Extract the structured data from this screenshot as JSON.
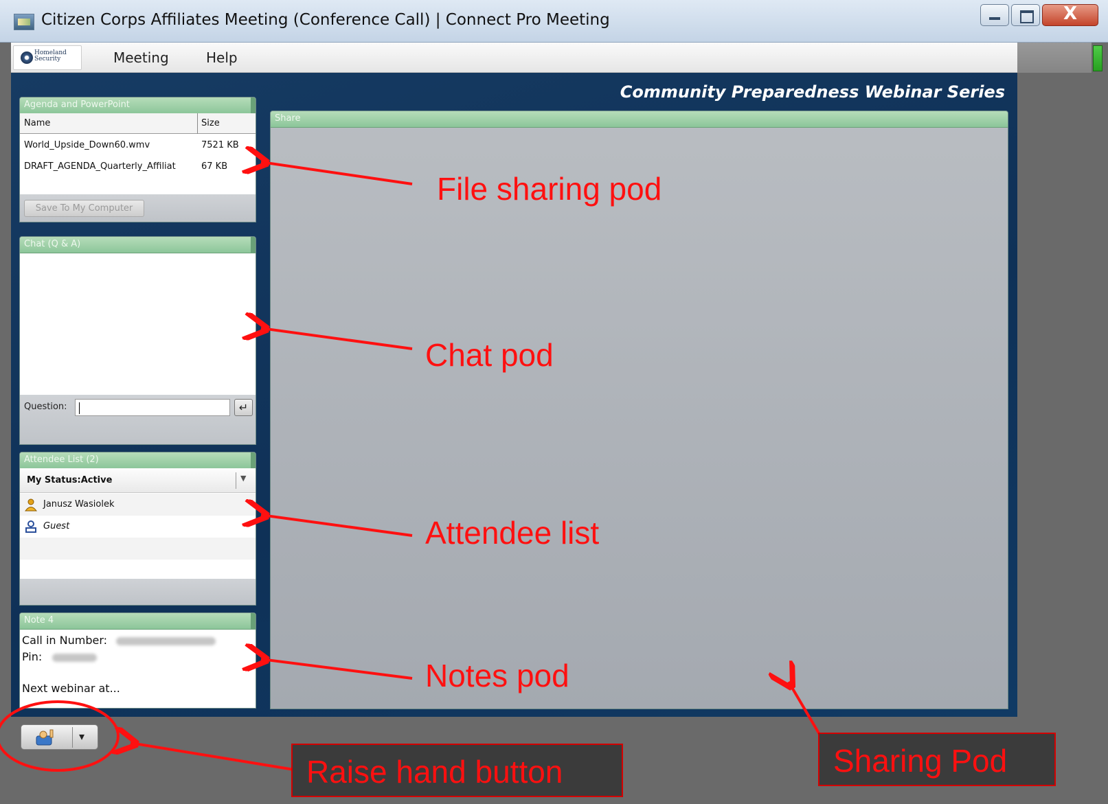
{
  "window": {
    "title": "Citizen Corps Affiliates Meeting (Conference Call) | Connect Pro Meeting",
    "controls": {
      "minimize": "",
      "maximize": "",
      "close": "X"
    }
  },
  "menubar": {
    "logo_text": "Homeland Security",
    "items": [
      "Meeting",
      "Help"
    ]
  },
  "banner": {
    "title": "Community Preparedness Webinar Series"
  },
  "file_pod": {
    "title": "Agenda and PowerPoint",
    "columns": [
      "Name",
      "Size"
    ],
    "rows": [
      {
        "name": "World_Upside_Down60.wmv",
        "size": "7521 KB"
      },
      {
        "name": "DRAFT_AGENDA_Quarterly_Affiliat",
        "size": "67 KB"
      }
    ],
    "save_button": "Save To My Computer"
  },
  "chat_pod": {
    "title": "Chat (Q & A)",
    "question_label": "Question:",
    "question_value": "",
    "send_icon": "↵"
  },
  "attendee_pod": {
    "title": "Attendee List (2)",
    "my_status": "My Status:Active",
    "attendees": [
      {
        "name": "Janusz Wasiolek",
        "role_icon": "host-icon"
      },
      {
        "name": "Guest",
        "role_icon": "guest-icon"
      }
    ]
  },
  "notes_pod": {
    "title": "Note 4",
    "call_in_label": "Call in Number:",
    "pin_label": "Pin:",
    "next_text": "Next webinar at..."
  },
  "share_pod": {
    "title": "Share"
  },
  "raise_hand": {
    "arrow": "▾"
  },
  "annotations": {
    "file_sharing": "File sharing pod",
    "chat": "Chat pod",
    "attendee": "Attendee list",
    "notes": "Notes pod",
    "raise_hand": "Raise hand button",
    "sharing": "Sharing Pod"
  },
  "colors": {
    "annotation_red": "#ff1010",
    "pod_header_green": "#8cc69a",
    "meeting_background": "#0f3157",
    "share_gray": "#a4a9b0"
  }
}
